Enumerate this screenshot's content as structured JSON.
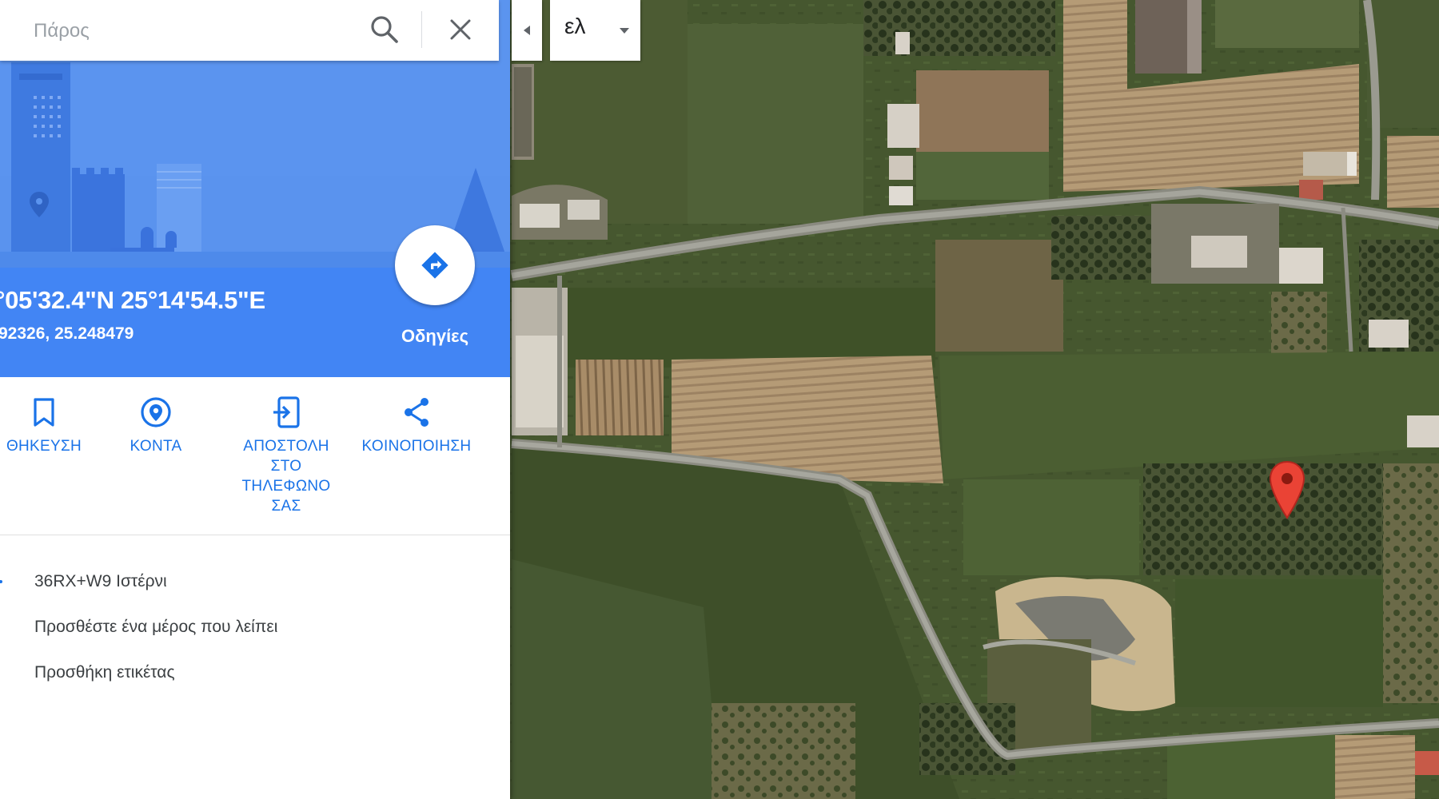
{
  "search": {
    "placeholder": "Πάρος",
    "value": ""
  },
  "language": {
    "label": "ελ"
  },
  "place": {
    "coordinates_dms": "°05'32.4\"N 25°14'54.5\"E",
    "coordinates_decimal": "92326, 25.248479",
    "directions_label": "Οδηγίες"
  },
  "actions": [
    {
      "label": "ΘΗΚΕΥΣΗ",
      "icon": "bookmark-icon"
    },
    {
      "label": "ΚΟΝΤΑ",
      "icon": "place-pin-icon"
    },
    {
      "label": "ΑΠΟΣΤΟΛΗ ΣΤΟ ΤΗΛΕΦΩΝΟ ΣΑΣ",
      "icon": "send-to-phone-icon"
    },
    {
      "label": "ΚΟΙΝΟΠΟΙΗΣΗ",
      "icon": "share-icon"
    }
  ],
  "info_rows": [
    {
      "text": "36RX+W9 Ιστέρνι",
      "icon": "plus-code-icon"
    },
    {
      "text": "Προσθέστε ένα μέρος που λείπει",
      "icon": "add-place-icon"
    },
    {
      "text": "Προσθήκη ετικέτας",
      "icon": "label-icon"
    }
  ],
  "colors": {
    "brand_blue": "#4285f4",
    "action_blue": "#1a73e8",
    "pin_red": "#ea4335"
  }
}
